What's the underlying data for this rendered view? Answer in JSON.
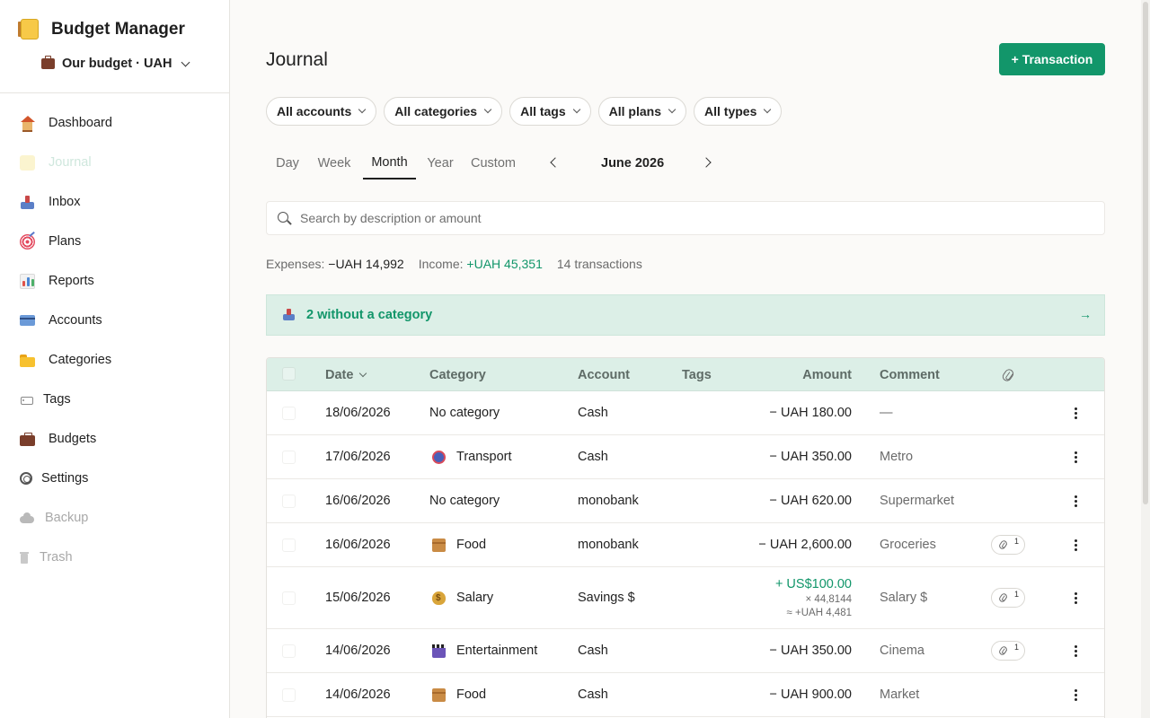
{
  "app": {
    "title": "Budget Manager",
    "logo_icon": "notebook-icon"
  },
  "budget_selector": {
    "label": "Our budget · UAH"
  },
  "sidebar": {
    "items": [
      {
        "label": "Dashboard",
        "icon": "house-icon",
        "state": "normal"
      },
      {
        "label": "Journal",
        "icon": "notebook-icon",
        "state": "active"
      },
      {
        "label": "Inbox",
        "icon": "inbox-tray-icon",
        "state": "normal"
      },
      {
        "label": "Plans",
        "icon": "target-icon",
        "state": "normal"
      },
      {
        "label": "Reports",
        "icon": "bar-chart-icon",
        "state": "normal"
      },
      {
        "label": "Accounts",
        "icon": "credit-card-icon",
        "state": "normal"
      },
      {
        "label": "Categories",
        "icon": "folder-icon",
        "state": "normal"
      },
      {
        "label": "Tags",
        "icon": "tag-icon",
        "state": "normal"
      },
      {
        "label": "Budgets",
        "icon": "briefcase-icon",
        "state": "normal"
      },
      {
        "label": "Settings",
        "icon": "gear-icon",
        "state": "normal"
      },
      {
        "label": "Backup",
        "icon": "cloud-icon",
        "state": "disabled"
      },
      {
        "label": "Trash",
        "icon": "trash-icon",
        "state": "disabled"
      }
    ]
  },
  "header": {
    "title": "Journal",
    "add_button": "+ Transaction"
  },
  "filters": [
    "All accounts",
    "All categories",
    "All tags",
    "All plans",
    "All types"
  ],
  "period": {
    "tabs": [
      "Day",
      "Week",
      "Month",
      "Year",
      "Custom"
    ],
    "active": "Month",
    "label": "June 2026"
  },
  "search": {
    "placeholder": "Search by description or amount",
    "value": ""
  },
  "summary": {
    "expenses_label": "Expenses:",
    "expenses_value": "−UAH 14,992",
    "income_label": "Income:",
    "income_value": "+UAH 45,351",
    "count": "14 transactions"
  },
  "banner": {
    "text": "2 without a category",
    "arrow": "→"
  },
  "table": {
    "columns": {
      "date": "Date",
      "category": "Category",
      "account": "Account",
      "tags": "Tags",
      "amount": "Amount",
      "comment": "Comment"
    },
    "rows": [
      {
        "date": "18/06/2026",
        "category": "No category",
        "cat_icon": "",
        "account": "Cash",
        "tags": "",
        "amount": "− UAH 180.00",
        "comment": "—",
        "attachments": ""
      },
      {
        "date": "17/06/2026",
        "category": "Transport",
        "cat_icon": "metro-icon",
        "account": "Cash",
        "tags": "",
        "amount": "− UAH 350.00",
        "comment": "Metro",
        "attachments": ""
      },
      {
        "date": "16/06/2026",
        "category": "No category",
        "cat_icon": "",
        "account": "monobank",
        "tags": "",
        "amount": "− UAH 620.00",
        "comment": "Supermarket",
        "attachments": ""
      },
      {
        "date": "16/06/2026",
        "category": "Food",
        "cat_icon": "package-icon",
        "account": "monobank",
        "tags": "",
        "amount": "− UAH 2,600.00",
        "comment": "Groceries",
        "attachments": "1"
      },
      {
        "date": "15/06/2026",
        "category": "Salary",
        "cat_icon": "money-bag-icon",
        "account": "Savings $",
        "tags": "",
        "amount": "+ US$100.00",
        "rate": "× 44,8144",
        "converted": "≈ +UAH 4,481",
        "comment": "Salary $",
        "attachments": "1"
      },
      {
        "date": "14/06/2026",
        "category": "Entertainment",
        "cat_icon": "clapperboard-icon",
        "account": "Cash",
        "tags": "",
        "amount": "− UAH 350.00",
        "comment": "Cinema",
        "attachments": "1"
      },
      {
        "date": "14/06/2026",
        "category": "Food",
        "cat_icon": "package-icon",
        "account": "Cash",
        "tags": "",
        "amount": "− UAH 900.00",
        "comment": "Market",
        "attachments": ""
      }
    ]
  },
  "colors": {
    "accent": "#12966a",
    "banner_bg": "#dcefe7",
    "header_bg": "#dcefe7"
  }
}
